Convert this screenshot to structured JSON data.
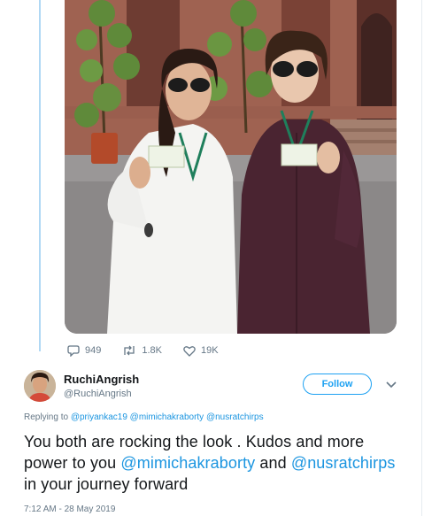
{
  "tweet": {
    "actions": {
      "replies": "949",
      "retweets": "1.8K",
      "likes": "19K"
    }
  },
  "reply": {
    "display_name": "RuchiAngrish",
    "handle": "@RuchiAngrish",
    "follow_label": "Follow",
    "replying_prefix": "Replying to ",
    "replying_to": [
      "@priyankac19",
      "@mimichakraborty",
      "@nusratchirps"
    ],
    "text_part1": "You both are rocking the look . Kudos and more power to you ",
    "mention1": "@mimichakraborty",
    "text_part2": " and ",
    "mention2": "@nusratchirps",
    "text_part3": " in your journey forward",
    "timestamp": "7:12 AM - 28 May 2019"
  },
  "colors": {
    "accent": "#1da1f2",
    "link": "#1b95e0",
    "secondary_text": "#657786",
    "thread_line": "#b0d8f4"
  },
  "icons": [
    "reply-icon",
    "retweet-icon",
    "like-icon",
    "chevron-down-icon"
  ]
}
